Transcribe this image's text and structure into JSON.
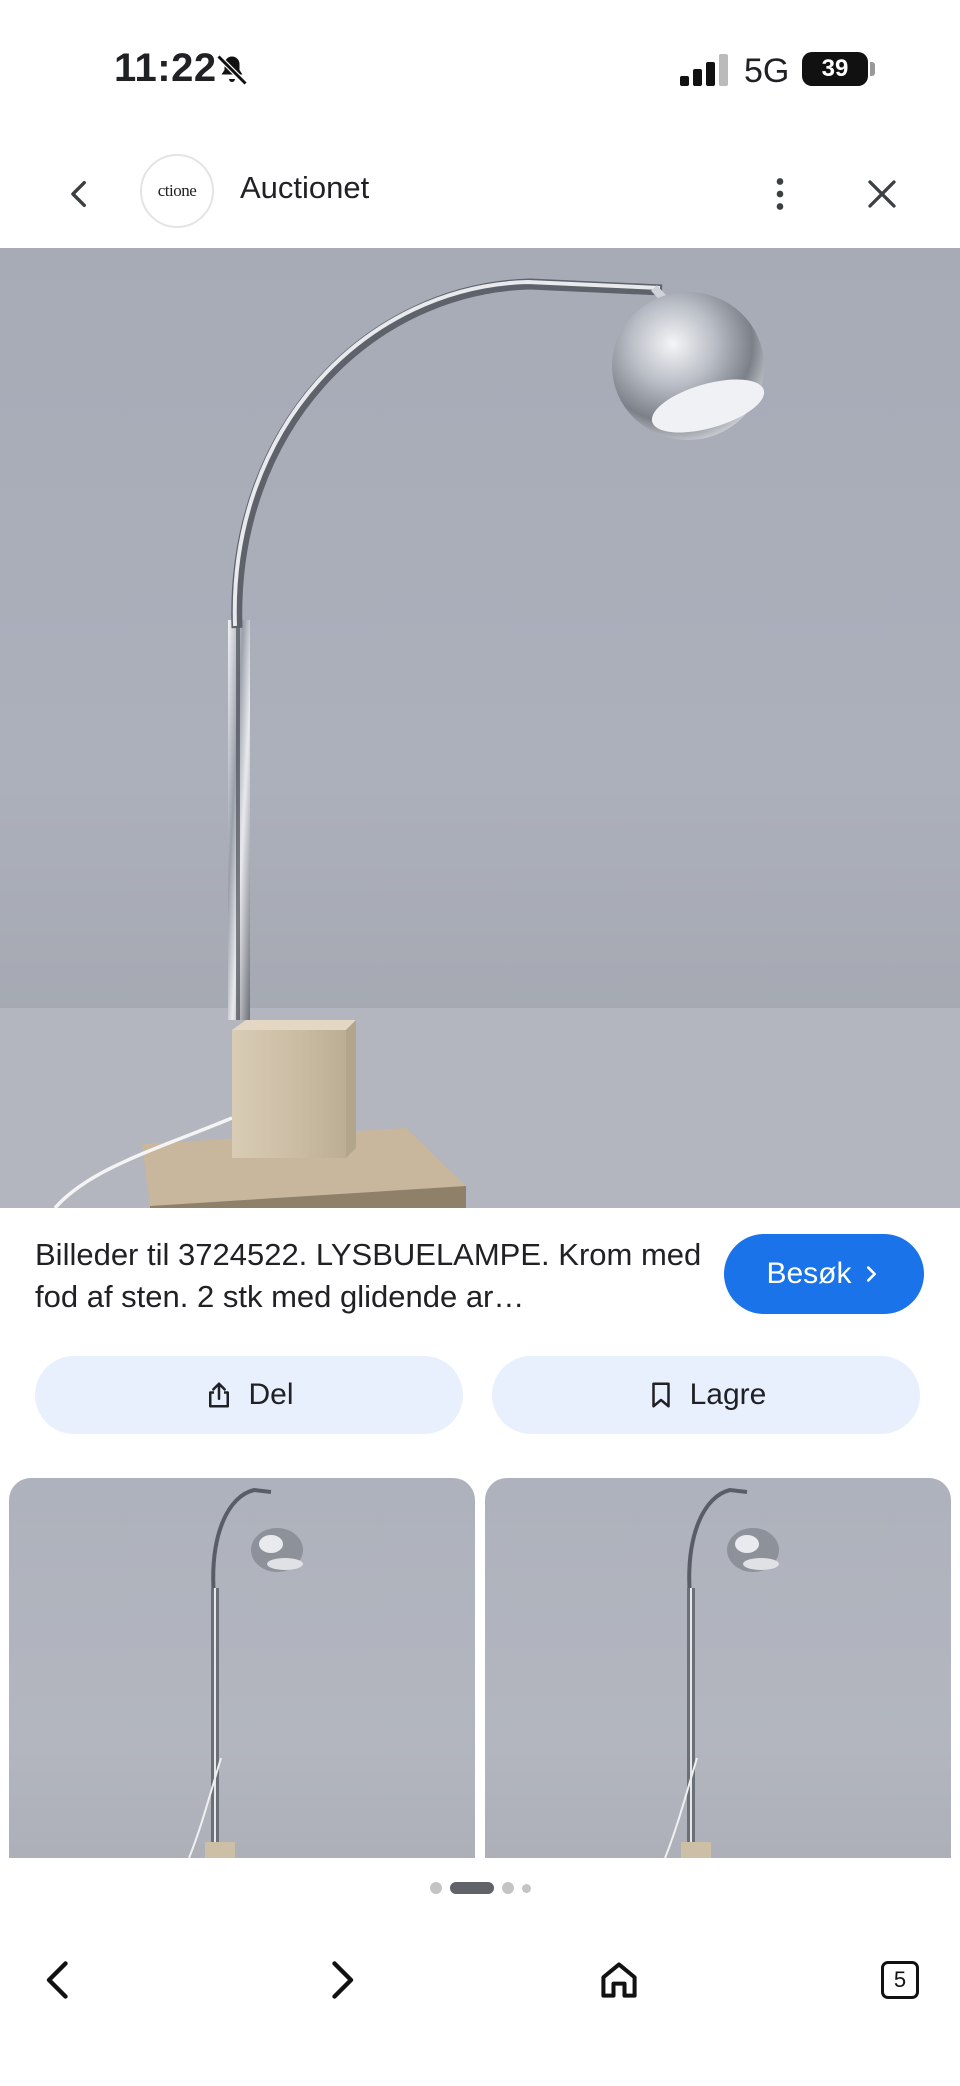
{
  "status_bar": {
    "time": "11:22",
    "network": "5G",
    "battery": "39"
  },
  "header": {
    "site_name": "Auctionet",
    "logo_text": "ctione"
  },
  "icons": {
    "bell": "bell-slash-icon",
    "signal": "signal-icon",
    "back": "chevron-left-icon",
    "more": "more-vertical-icon",
    "close": "close-icon",
    "share": "share-icon",
    "bookmark": "bookmark-icon",
    "home": "home-icon"
  },
  "result": {
    "caption": "Billeder til 3724522. LYSBUELAMPE. Krom med fod af sten. 2 stk med glidende ar…",
    "visit_label": "Besøk",
    "share_label": "Del",
    "save_label": "Lagre"
  },
  "pagination": {
    "count": 4,
    "active": 1
  },
  "nav": {
    "tabs_count": "5"
  },
  "colors": {
    "accent": "#1a73e8",
    "pill_bg": "#e8f0fe"
  }
}
